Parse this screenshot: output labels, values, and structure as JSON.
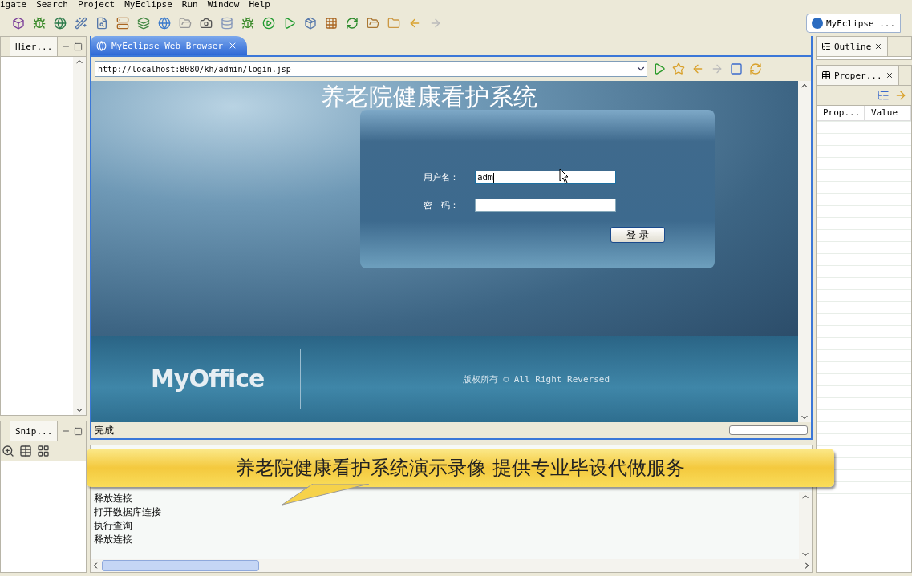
{
  "menu": [
    "igate",
    "Search",
    "Project",
    "MyEclipse",
    "Run",
    "Window",
    "Help"
  ],
  "perspective": {
    "label": "MyEclipse ..."
  },
  "left_top_view": {
    "tab": "Hier..."
  },
  "left_bottom_view": {
    "tab": "Snip..."
  },
  "editor": {
    "tab": "MyEclipse Web Browser",
    "url": "http://localhost:8080/kh/admin/login.jsp",
    "status": "完成",
    "progress": {
      "level": 0
    }
  },
  "page": {
    "title": "养老院健康看护系统",
    "fields": [
      {
        "label": "用户名：",
        "value": "adm",
        "focused": true
      },
      {
        "label": "密　码：",
        "focused": false
      }
    ],
    "button": "登 录",
    "logo": "MyOffice",
    "copyright": "版权所有 © All Right Reversed"
  },
  "console": {
    "lines": [
      "释放连接",
      "打开数据库连接",
      "执行查询",
      "释放连接"
    ]
  },
  "outline": {
    "tab": "Outline"
  },
  "properties": {
    "tab": "Proper...",
    "columns": [
      "Prop...",
      "Value"
    ]
  },
  "callout": {
    "text": "养老院健康看护系统演示录像 提供专业毕设代做服务"
  }
}
